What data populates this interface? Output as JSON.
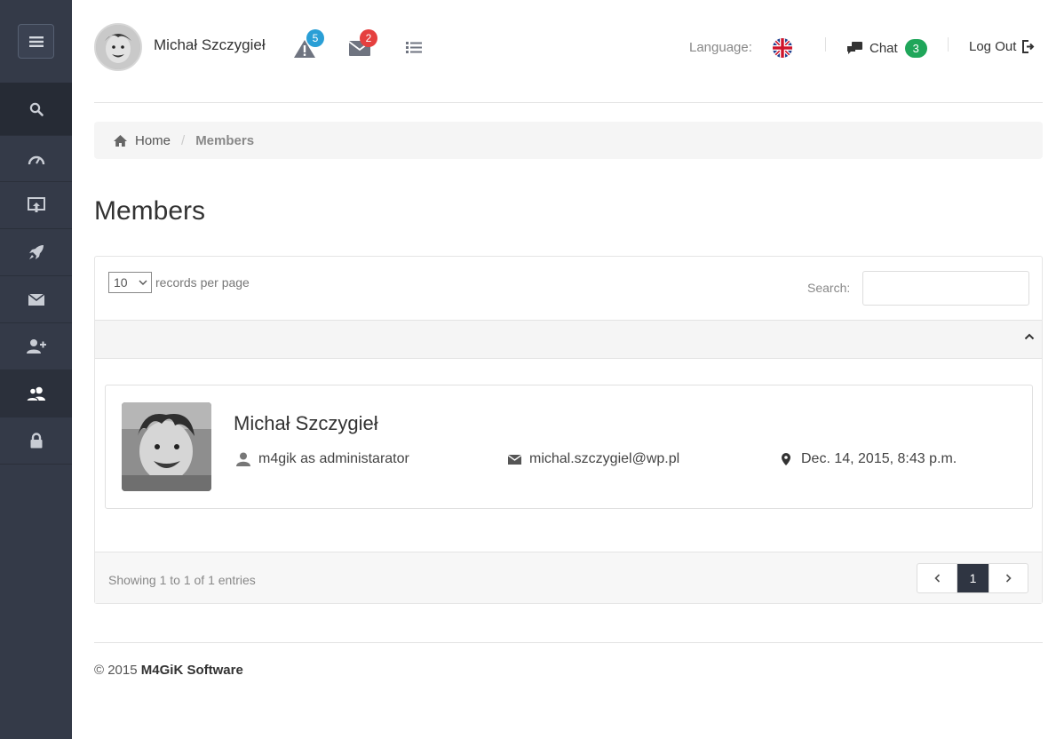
{
  "header": {
    "user_name": "Michał Szczygieł",
    "alerts_count": "5",
    "messages_count": "2",
    "language_label": "Language:",
    "chat_label": "Chat",
    "chat_count": "3",
    "logout_label": "Log Out"
  },
  "sidebar": {
    "items": [
      "search-icon",
      "dashboard-icon",
      "upload-icon",
      "rocket-icon",
      "mail-icon",
      "add-user-icon",
      "users-icon",
      "lock-icon"
    ],
    "active_item": "users-icon"
  },
  "breadcrumb": {
    "home": "Home",
    "current": "Members"
  },
  "page": {
    "title": "Members"
  },
  "table": {
    "records_per_page_value": "10",
    "records_per_page_label": "records per page",
    "search_label": "Search:",
    "search_value": "",
    "showing": "Showing 1 to 1 of 1 entries",
    "current_page": "1"
  },
  "member": {
    "name": "Michał Szczygieł",
    "role": "m4gik as administarator",
    "email": "michal.szczygiel@wp.pl",
    "joined": "Dec. 14, 2015, 8:43 p.m."
  },
  "footer": {
    "copyright": "© 2015",
    "company": "M4GiK Software"
  },
  "colors": {
    "sidebar_bg": "#343a48",
    "alerts_badge": "#2a9fd6",
    "messages_badge": "#e5403f",
    "chat_badge": "#1fa65a",
    "pager_active": "#2f3542"
  }
}
